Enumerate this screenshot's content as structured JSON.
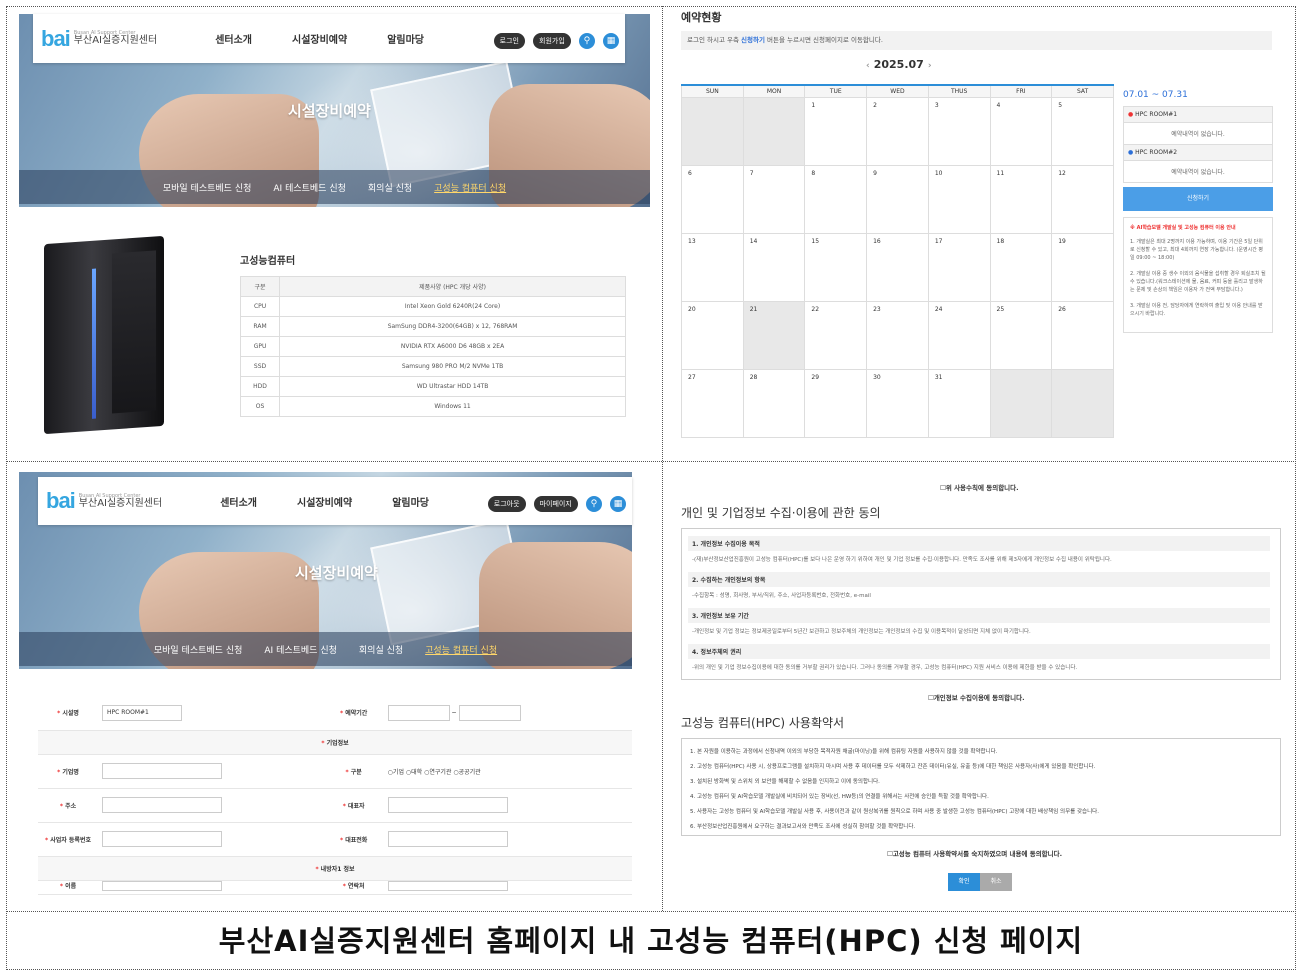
{
  "panel1": {
    "logo_mark": "bai",
    "logo_text": "부산AI실증지원센터",
    "logo_sub": "Busan AI Support Center",
    "menu": [
      "센터소개",
      "시설장비예약",
      "알림마당"
    ],
    "login": "로그인",
    "signup": "회원가입",
    "hero_title": "시설장비예약",
    "subnav": [
      "모바일 테스트베드 신청",
      "AI 테스트베드 신청",
      "회의실 신청",
      "고성능 컴퓨터 신청"
    ],
    "spec_title": "고성능컴퓨터",
    "spec_header": [
      "구분",
      "제품사양 (HPC 개당 사양)"
    ],
    "spec_rows": [
      [
        "CPU",
        "Intel Xeon Gold 6240R(24 Core)"
      ],
      [
        "RAM",
        "SamSung DDR4-3200(64GB) x 12, 768RAM"
      ],
      [
        "GPU",
        "NVIDIA RTX A6000 D6 48GB x 2EA"
      ],
      [
        "SSD",
        "Samsung 980 PRO M/2 NVMe 1TB"
      ],
      [
        "HDD",
        "WD Ultrastar HDD 14TB"
      ],
      [
        "OS",
        "Windows 11"
      ]
    ]
  },
  "panel2": {
    "title": "예약현황",
    "notice_pre": "로그인 하시고 우측 ",
    "notice_link": "신청하기",
    "notice_post": " 버튼을 누르시면 신청페이지로 이동합니다.",
    "month": "2025.07",
    "days": [
      "SUN",
      "MON",
      "TUE",
      "WED",
      "THUS",
      "FRI",
      "SAT"
    ],
    "weeks": [
      [
        "",
        "",
        "1",
        "2",
        "3",
        "4",
        "5"
      ],
      [
        "6",
        "7",
        "8",
        "9",
        "10",
        "11",
        "12"
      ],
      [
        "13",
        "14",
        "15",
        "16",
        "17",
        "18",
        "19"
      ],
      [
        "20",
        "21",
        "22",
        "23",
        "24",
        "25",
        "26"
      ],
      [
        "27",
        "28",
        "29",
        "30",
        "31",
        "",
        ""
      ]
    ],
    "range": "07.01 ~ 07.31",
    "rooms": [
      {
        "name": "HPC ROOM#1",
        "status": "예약내역이 없습니다."
      },
      {
        "name": "HPC ROOM#2",
        "status": "예약내역이 없습니다."
      }
    ],
    "apply": "신청하기",
    "guide_title": "※ AI학습모델 개발실 및 고성능 컴퓨터 이용 안내",
    "guide": [
      "1. 개발실은 최대 2명까지 이용 가능하며, 이용 기간은 5일 단위로 신청할 수 있고, 최대 4회까지 연장 가능합니다. (운영시간 평일 09:00 ~ 18:00)",
      "2. 개발실 이용 중 생수 이외의 음식물을 섭취할 경우 퇴실조치 될 수 있습니다.(워크스테이션에 물, 음료, 커피 등을 흘리고 발생하는 문제 및 손상의 책임은 이용자 가 전액 부담합니다.)",
      "3. 개발실 이용 전, 담당자에게 연락하여 출입 및 이용 안내를 받으시기 바랍니다."
    ]
  },
  "panel3": {
    "logout": "로그아웃",
    "mypage": "마이페이지",
    "labels": {
      "facility": "시설명",
      "period": "예약기간",
      "company_info": "기업정보",
      "company": "기업명",
      "type": "구분",
      "address": "주소",
      "ceo": "대표자",
      "bizno": "사업자 등록번호",
      "ceo_phone": "대표전화",
      "visitor": "내방자1 정보",
      "name": "이름",
      "contact": "연락처"
    },
    "facility_value": "HPC ROOM#1",
    "types": [
      "기업",
      "대학",
      "연구기관",
      "공공기관"
    ]
  },
  "panel4": {
    "agree_top": "위 사용수칙에 동의합니다.",
    "privacy_title": "개인 및 기업정보 수집·이용에 관한 동의",
    "privacy": [
      {
        "h": "1. 개인정보 수집이용 목적",
        "t": "-(재)부산정보산업진흥원이 고성능 컴퓨터(HPC)를 보다 나은 운영 하기 위하여 개인 및 기업 정보를 수집·이용합니다. 만족도 조사를 위해 제3자에게 개인정보 수집 내용이 위탁됩니다."
      },
      {
        "h": "2. 수집하는 개인정보의 항목",
        "t": "-수집항목 : 성명, 회사명, 부서/직위, 주소, 사업자등록번호, 전화번호, e-mail"
      },
      {
        "h": "3. 개인정보 보유 기간",
        "t": "-개인정보 및 기업 정보는 정보제공일로부터 5년간 보관하고 정보주체의 개인정보는 개인정보의 수집 및 이용목적이 달성되면 지체 없이 파기합니다."
      },
      {
        "h": "4. 정보주체의 권리",
        "t": "-위의 개인 및 기업 정보수집이용에 대한 동의를 거부할 권리가 있습니다. 그러나 동의를 거부할 경우, 고성능 컴퓨터(HPC) 지원 서비스 이용에 제한을 받을 수 있습니다."
      }
    ],
    "privacy_agree": "개인정보 수집이용에 동의합니다.",
    "hpc_title": "고성능 컴퓨터(HPC) 사용확약서",
    "hpc_rules": [
      "1. 본 자원을 이용하는 과정에서 신청내역 이외의 부당한 목적자원 채굴(마이닝)을 위해 컴퓨팅 자원을 사용하지 않을 것을 확약합니다.",
      "2. 고성능 컴퓨터(HPC) 사용 시, 상용프로그램을 설치하지 마시며 사용 후 데이터를 모두 삭제하고 잔존 데이터(유실, 유출 등)에 대한 책임은 사용자(사)에게 있음을 확인합니다.",
      "3. 설치된 방화벽 및 스위치 외 보안을 해제할 수 없음을 인지하고 이에 동의합니다.",
      "4. 고성능 컴퓨터 및 AI학습모델 개발실에 비치되어 있는 장비(선, HW등)의 연결을 위해서는 사전에 승인을 득할 것을 확약합니다.",
      "5. 사용자는 고성능 컴퓨터 및 AI학습모델 개발실 사용 후, 사용이전과 같이 원상복귀를 원칙으로 하며 사용 중 발생한 고성능 컴퓨터(HPC) 고장에 대한 배상책임 의무를 갖습니다.",
      "6. 부산정보산업진흥원에서 요구하는 결과보고서와 만족도 조사에 성실히 참여할 것을 확약합니다."
    ],
    "hpc_agree": "고성능 컴퓨터 사용확약서를 숙지하였으며 내용에 동의합니다.",
    "confirm": "확인",
    "cancel": "취소"
  },
  "caption": "부산AI실증지원센터 홈페이지 내 고성능 컴퓨터(HPC) 신청 페이지",
  "colors": {
    "accent": "#2c8ed8",
    "apply": "#4b9ee7",
    "alert": "#e33333"
  }
}
